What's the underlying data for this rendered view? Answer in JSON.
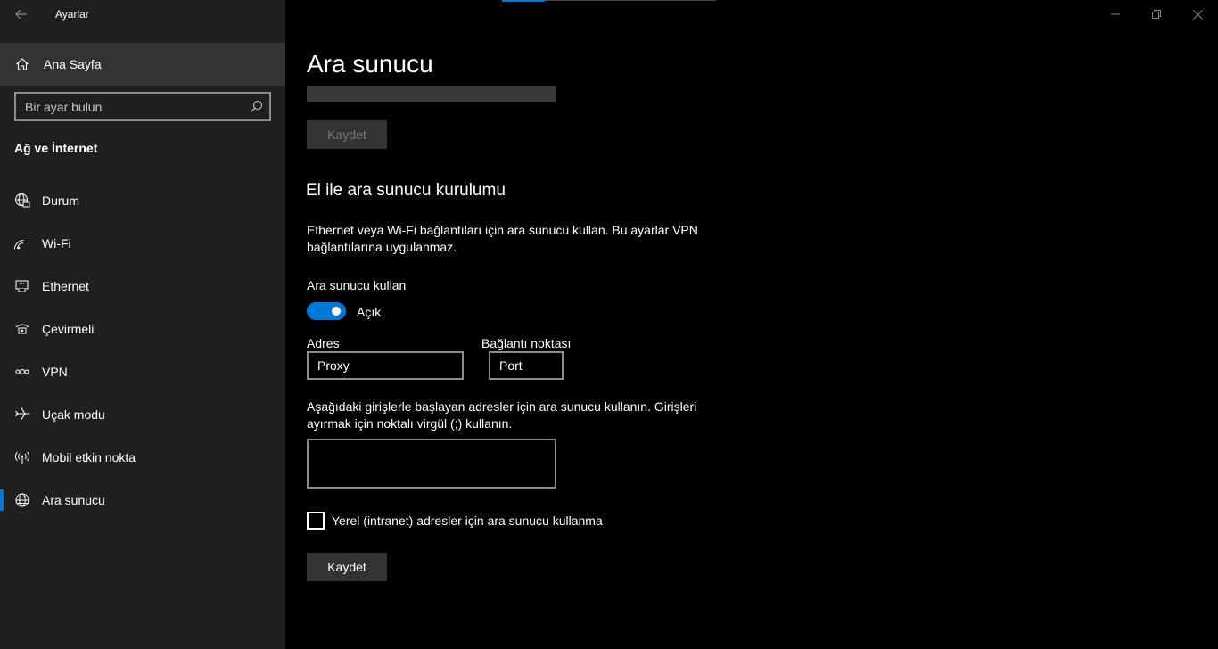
{
  "window": {
    "title": "Ayarlar"
  },
  "sidebar": {
    "home_label": "Ana Sayfa",
    "search_placeholder": "Bir ayar bulun",
    "section_title": "Ağ ve İnternet",
    "items": [
      {
        "label": "Durum",
        "icon": "globe-status-icon"
      },
      {
        "label": "Wi-Fi",
        "icon": "wifi-icon"
      },
      {
        "label": "Ethernet",
        "icon": "ethernet-icon"
      },
      {
        "label": "Çevirmeli",
        "icon": "dialup-icon"
      },
      {
        "label": "VPN",
        "icon": "vpn-icon"
      },
      {
        "label": "Uçak modu",
        "icon": "airplane-icon"
      },
      {
        "label": "Mobil etkin nokta",
        "icon": "hotspot-icon"
      },
      {
        "label": "Ara sunucu",
        "icon": "globe-icon",
        "active": true
      }
    ]
  },
  "main": {
    "title": "Ara sunucu",
    "save_disabled_label": "Kaydet",
    "manual_heading": "El ile ara sunucu kurulumu",
    "manual_description": "Ethernet veya Wi-Fi bağlantıları için ara sunucu kullan. Bu ayarlar VPN bağlantılarına uygulanmaz.",
    "use_proxy_label": "Ara sunucu kullan",
    "toggle_state_label": "Açık",
    "address_label": "Adres",
    "address_value": "Proxy",
    "port_label": "Bağlantı noktası",
    "port_value": "Port",
    "exceptions_description": "Aşağıdaki girişlerle başlayan adresler için ara sunucu kullanın. Girişleri ayırmak için noktalı virgül (;) kullanın.",
    "exceptions_value": "",
    "local_bypass_label": "Yerel (intranet) adresler için ara sunucu kullanma",
    "local_bypass_checked": false,
    "save_label": "Kaydet"
  },
  "colors": {
    "accent": "#0078d7",
    "sidebar_bg": "#1f1f1f",
    "content_bg": "#000000"
  }
}
